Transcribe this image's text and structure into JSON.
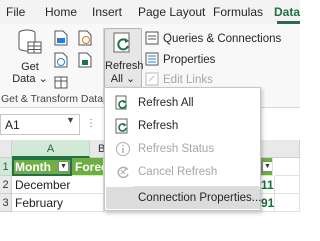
{
  "ribbon_tabs": [
    "File",
    "Home",
    "Insert",
    "Page Layout",
    "Formulas",
    "Data"
  ],
  "active_tab": "Data",
  "get_data": {
    "line1": "Get",
    "line2": "Data",
    "arrow": "⌄"
  },
  "group_label": "Get & Transform Data",
  "refresh_all": {
    "line1": "Refresh",
    "line2": "All",
    "arrow": "⌄"
  },
  "queries_group": {
    "queries_connections": "Queries & Connections",
    "properties": "Properties",
    "edit_links": "Edit Links"
  },
  "name_box": {
    "value": "A1"
  },
  "sheet": {
    "columns": [
      "A",
      "B"
    ],
    "rows": [
      "1",
      "2",
      "3"
    ],
    "header_row": [
      "Month",
      "Foreca"
    ],
    "data_rows": [
      [
        "December"
      ],
      [
        "February"
      ]
    ],
    "right_fragments": [
      "11",
      "91"
    ]
  },
  "refresh_menu": {
    "items": [
      {
        "label": "Refresh All",
        "disabled": false
      },
      {
        "label": "Refresh",
        "disabled": false
      },
      {
        "label": "Refresh Status",
        "disabled": true
      },
      {
        "label": "Cancel Refresh",
        "disabled": true
      },
      {
        "label": "Connection Properties...",
        "disabled": false
      }
    ]
  },
  "colors": {
    "accent": "#217346",
    "table_header": "#70ad47",
    "disabled": "#a6a6a6"
  }
}
